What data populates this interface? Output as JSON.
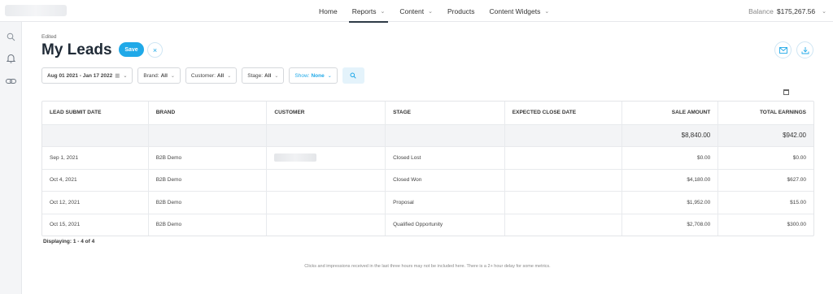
{
  "topnav": {
    "items": [
      {
        "label": "Home",
        "dropdown": false,
        "active": false
      },
      {
        "label": "Reports",
        "dropdown": true,
        "active": true
      },
      {
        "label": "Content",
        "dropdown": true,
        "active": false
      },
      {
        "label": "Products",
        "dropdown": false,
        "active": false
      },
      {
        "label": "Content Widgets",
        "dropdown": true,
        "active": false
      }
    ],
    "balance_label": "Balance",
    "balance_value": "$175,267.56"
  },
  "sidebar": {
    "icons": [
      "search-icon",
      "bell-icon",
      "link-icon"
    ]
  },
  "header": {
    "status": "Edited",
    "title": "My Leads",
    "save_label": "Save",
    "close_glyph": "×"
  },
  "filters": {
    "date_range": "Aug 01 2021 - Jan 17 2022",
    "brand_label": "Brand:",
    "brand_value": "All",
    "customer_label": "Customer:",
    "customer_value": "All",
    "stage_label": "Stage:",
    "stage_value": "All",
    "show_label": "Show:",
    "show_value": "None"
  },
  "table": {
    "columns": [
      "LEAD SUBMIT DATE",
      "BRAND",
      "CUSTOMER",
      "STAGE",
      "EXPECTED CLOSE DATE",
      "SALE AMOUNT",
      "TOTAL EARNINGS"
    ],
    "totals": {
      "sale_amount": "$8,840.00",
      "total_earnings": "$942.00"
    },
    "rows": [
      {
        "date": "Sep 1, 2021",
        "brand": "B2B Demo",
        "customer": "",
        "stage": "Closed Lost",
        "close": "",
        "sale": "$0.00",
        "earnings": "$0.00"
      },
      {
        "date": "Oct 4, 2021",
        "brand": "B2B Demo",
        "customer": "",
        "stage": "Closed Won",
        "close": "",
        "sale": "$4,180.00",
        "earnings": "$627.00"
      },
      {
        "date": "Oct 12, 2021",
        "brand": "B2B Demo",
        "customer": "",
        "stage": "Proposal",
        "close": "",
        "sale": "$1,952.00",
        "earnings": "$15.00"
      },
      {
        "date": "Oct 15, 2021",
        "brand": "B2B Demo",
        "customer": "",
        "stage": "Qualified Opportunity",
        "close": "",
        "sale": "$2,708.00",
        "earnings": "$300.00"
      }
    ]
  },
  "displaying": "Displaying: 1 - 4 of 4",
  "footnote": "Clicks and impressions received in the last three hours may not be included here. There is a 2+ hour delay for some metrics.",
  "colors": {
    "accent": "#20a9e8",
    "title": "#1f2a36"
  }
}
